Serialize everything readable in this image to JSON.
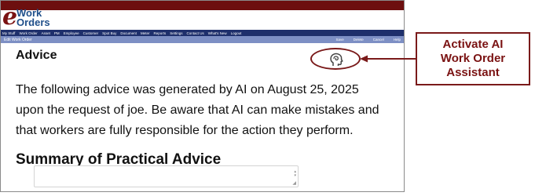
{
  "logo": {
    "letter": "e",
    "line1": "Work",
    "line2": "Orders"
  },
  "menu": {
    "items": [
      "My Stuff",
      "Work Order",
      "Asset",
      "PM",
      "Employee",
      "Customer",
      "Spot Buy",
      "Document",
      "Meter",
      "Reports",
      "Settings",
      "Contact Us",
      "What's New",
      "Logout"
    ]
  },
  "subbar": {
    "title": "Edit Work Order",
    "actions": [
      "Save",
      "Delete",
      "Cancel",
      "Help"
    ]
  },
  "advice": {
    "heading": "Advice",
    "line1": "The following advice was generated by AI on August 25, 2025",
    "line2": "upon the request of joe. Be aware that AI can make mistakes and",
    "line3": "that workers are fully responsible for the action they perform.",
    "summary_heading": "Summary of Practical Advice"
  },
  "icons": {
    "ai_assistant": "head-brain-icon",
    "textarea_scroll": "scroll-arrows-icon",
    "textarea_resize": "resize-grip-icon"
  },
  "callout": {
    "line1": "Activate AI",
    "line2": "Work Order",
    "line3": "Assistant"
  },
  "colors": {
    "brand_dark_red": "#6d0f0f",
    "menu_navy": "#1e2f6b",
    "subbar_blue": "#7d8fc4",
    "annotation_red": "#7a1a1a"
  }
}
